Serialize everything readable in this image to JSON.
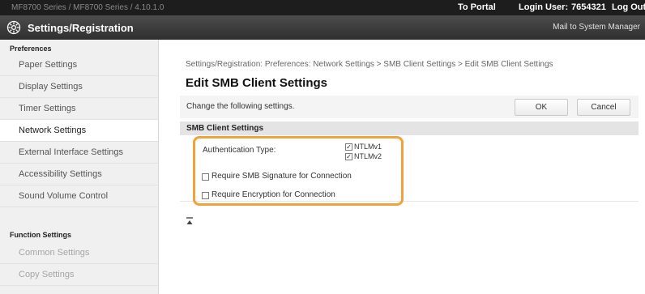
{
  "header": {
    "device_name": "MF8700 Series / MF8700 Series / 4.10.1.0",
    "to_portal": "To Portal",
    "login_user_label": "Login User:",
    "login_user_id": "7654321",
    "logout": "Log Out",
    "title": "Settings/Registration",
    "mail_to_admin": "Mail to System Manager"
  },
  "sidebar": {
    "preferences_heading": "Preferences",
    "preferences_items": [
      {
        "label": "Paper Settings"
      },
      {
        "label": "Display Settings"
      },
      {
        "label": "Timer Settings"
      },
      {
        "label": "Network Settings"
      },
      {
        "label": "External Interface Settings"
      },
      {
        "label": "Accessibility Settings"
      },
      {
        "label": "Sound Volume Control"
      }
    ],
    "function_heading": "Function Settings",
    "function_items": [
      {
        "label": "Common Settings"
      },
      {
        "label": "Copy Settings"
      }
    ]
  },
  "main": {
    "breadcrumb": "Settings/Registration: Preferences: Network Settings > SMB Client Settings > Edit SMB Client Settings",
    "title": "Edit SMB Client Settings",
    "instruction": "Change the following settings.",
    "ok_label": "OK",
    "cancel_label": "Cancel",
    "section_title": "SMB Client Settings",
    "auth_type_label": "Authentication Type:",
    "ntlmv1_label": "NTLMv1",
    "ntlmv1_checked": true,
    "ntlmv2_label": "NTLMv2",
    "ntlmv2_checked": true,
    "require_signature_label": "Require SMB Signature for Connection",
    "require_signature_checked": false,
    "require_encryption_label": "Require Encryption for Connection",
    "require_encryption_checked": false
  },
  "colors": {
    "highlight": "#f2a23a",
    "topbar": "#1d1d1d",
    "titlebar": "#3a3a3a"
  }
}
